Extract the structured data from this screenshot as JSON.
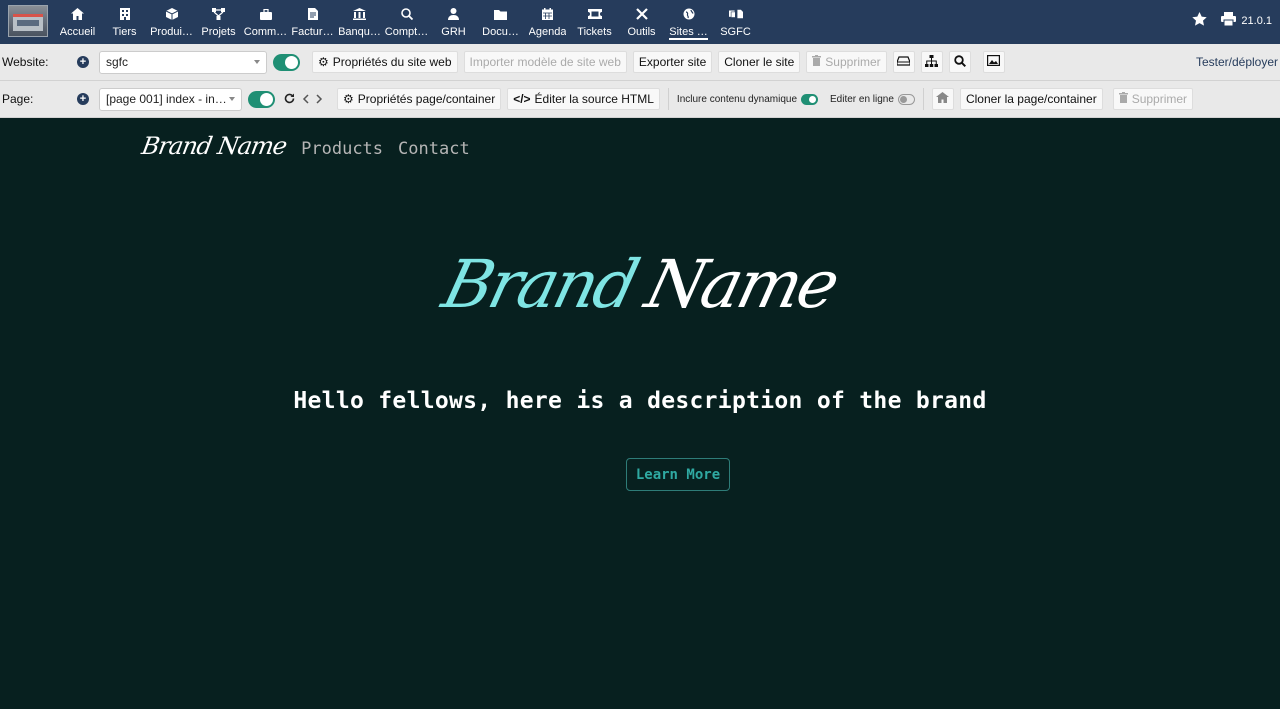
{
  "nav": {
    "items": [
      {
        "label": "Accueil",
        "icon": "home-icon"
      },
      {
        "label": "Tiers",
        "icon": "building-icon"
      },
      {
        "label": "Produi…",
        "icon": "cube-icon"
      },
      {
        "label": "Projets",
        "icon": "project-icon"
      },
      {
        "label": "Comm…",
        "icon": "briefcase-icon"
      },
      {
        "label": "Factur…",
        "icon": "invoice-icon"
      },
      {
        "label": "Banqu…",
        "icon": "bank-icon"
      },
      {
        "label": "Compt…",
        "icon": "search-dollar-icon"
      },
      {
        "label": "GRH",
        "icon": "user-tie-icon"
      },
      {
        "label": "Docu…",
        "icon": "folder-icon"
      },
      {
        "label": "Agenda",
        "icon": "calendar-icon"
      },
      {
        "label": "Tickets",
        "icon": "ticket-icon"
      },
      {
        "label": "Outils",
        "icon": "tools-icon"
      },
      {
        "label": "Sites …",
        "icon": "globe-icon"
      },
      {
        "label": "SGFC",
        "icon": "docs-icon"
      }
    ],
    "version": "21.0.1"
  },
  "website_bar": {
    "label": "Website:",
    "site_value": "sgfc",
    "props_btn": "Propriétés du site web",
    "import_btn": "Importer modèle de site web",
    "export_btn": "Exporter site",
    "clone_btn": "Cloner le site",
    "delete_btn": "Supprimer",
    "test_link": "Tester/déployer"
  },
  "page_bar": {
    "label": "Page:",
    "page_value": "[page 001] index - in…",
    "props_btn": "Propriétés page/container",
    "edit_html_btn": "Éditer la source HTML",
    "dynamic_label": "Inclure contenu dynamique",
    "inline_label": "Editer en ligne",
    "clone_btn": "Cloner la page/container",
    "delete_btn": "Supprimer"
  },
  "site": {
    "brand": "Brand Name",
    "links": [
      "Products",
      "Contact"
    ],
    "hero_part1": "Brand",
    "hero_part2": "Name",
    "tagline": "Hello fellows, here is a description of the brand",
    "cta": "Learn More"
  },
  "colors": {
    "nav_bg": "#263c5c",
    "toggle_on": "#1f8f74",
    "canvas_bg": "#07201f",
    "hero_accent": "#7fe5e4",
    "cta_color": "#2fa9a2"
  }
}
